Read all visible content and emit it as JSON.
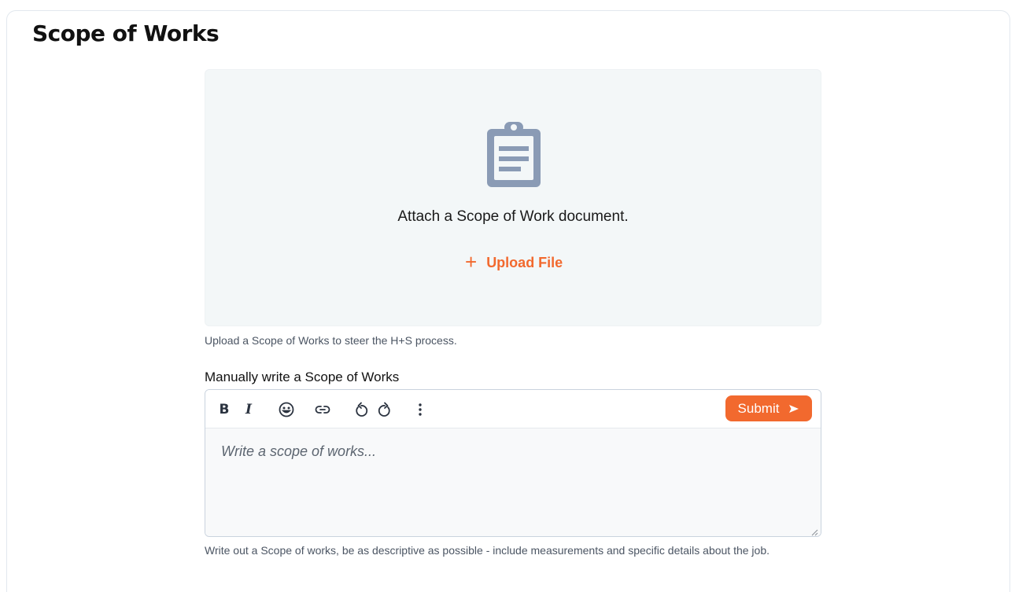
{
  "page": {
    "title": "Scope of Works"
  },
  "dropzone": {
    "icon": "clipboard-icon",
    "title": "Attach a Scope of Work document.",
    "upload_label": "Upload File",
    "upload_icon": "plus-icon",
    "hint": "Upload a Scope of Works to steer the H+S process."
  },
  "manual": {
    "label": "Manually write a Scope of Works",
    "toolbar": {
      "bold": "B",
      "italic": "I",
      "icons": [
        "emoji-icon",
        "link-icon",
        "undo-icon",
        "redo-icon",
        "more-vertical-icon"
      ],
      "submit_label": "Submit"
    },
    "placeholder": "Write a scope of works...",
    "value": "",
    "hint": "Write out a Scope of works, be as descriptive as possible - include measurements and specific details about the job."
  },
  "colors": {
    "accent": "#f2692e",
    "icon_gray": "#8a9bb5",
    "dropzone_bg": "#f3f7f8"
  }
}
